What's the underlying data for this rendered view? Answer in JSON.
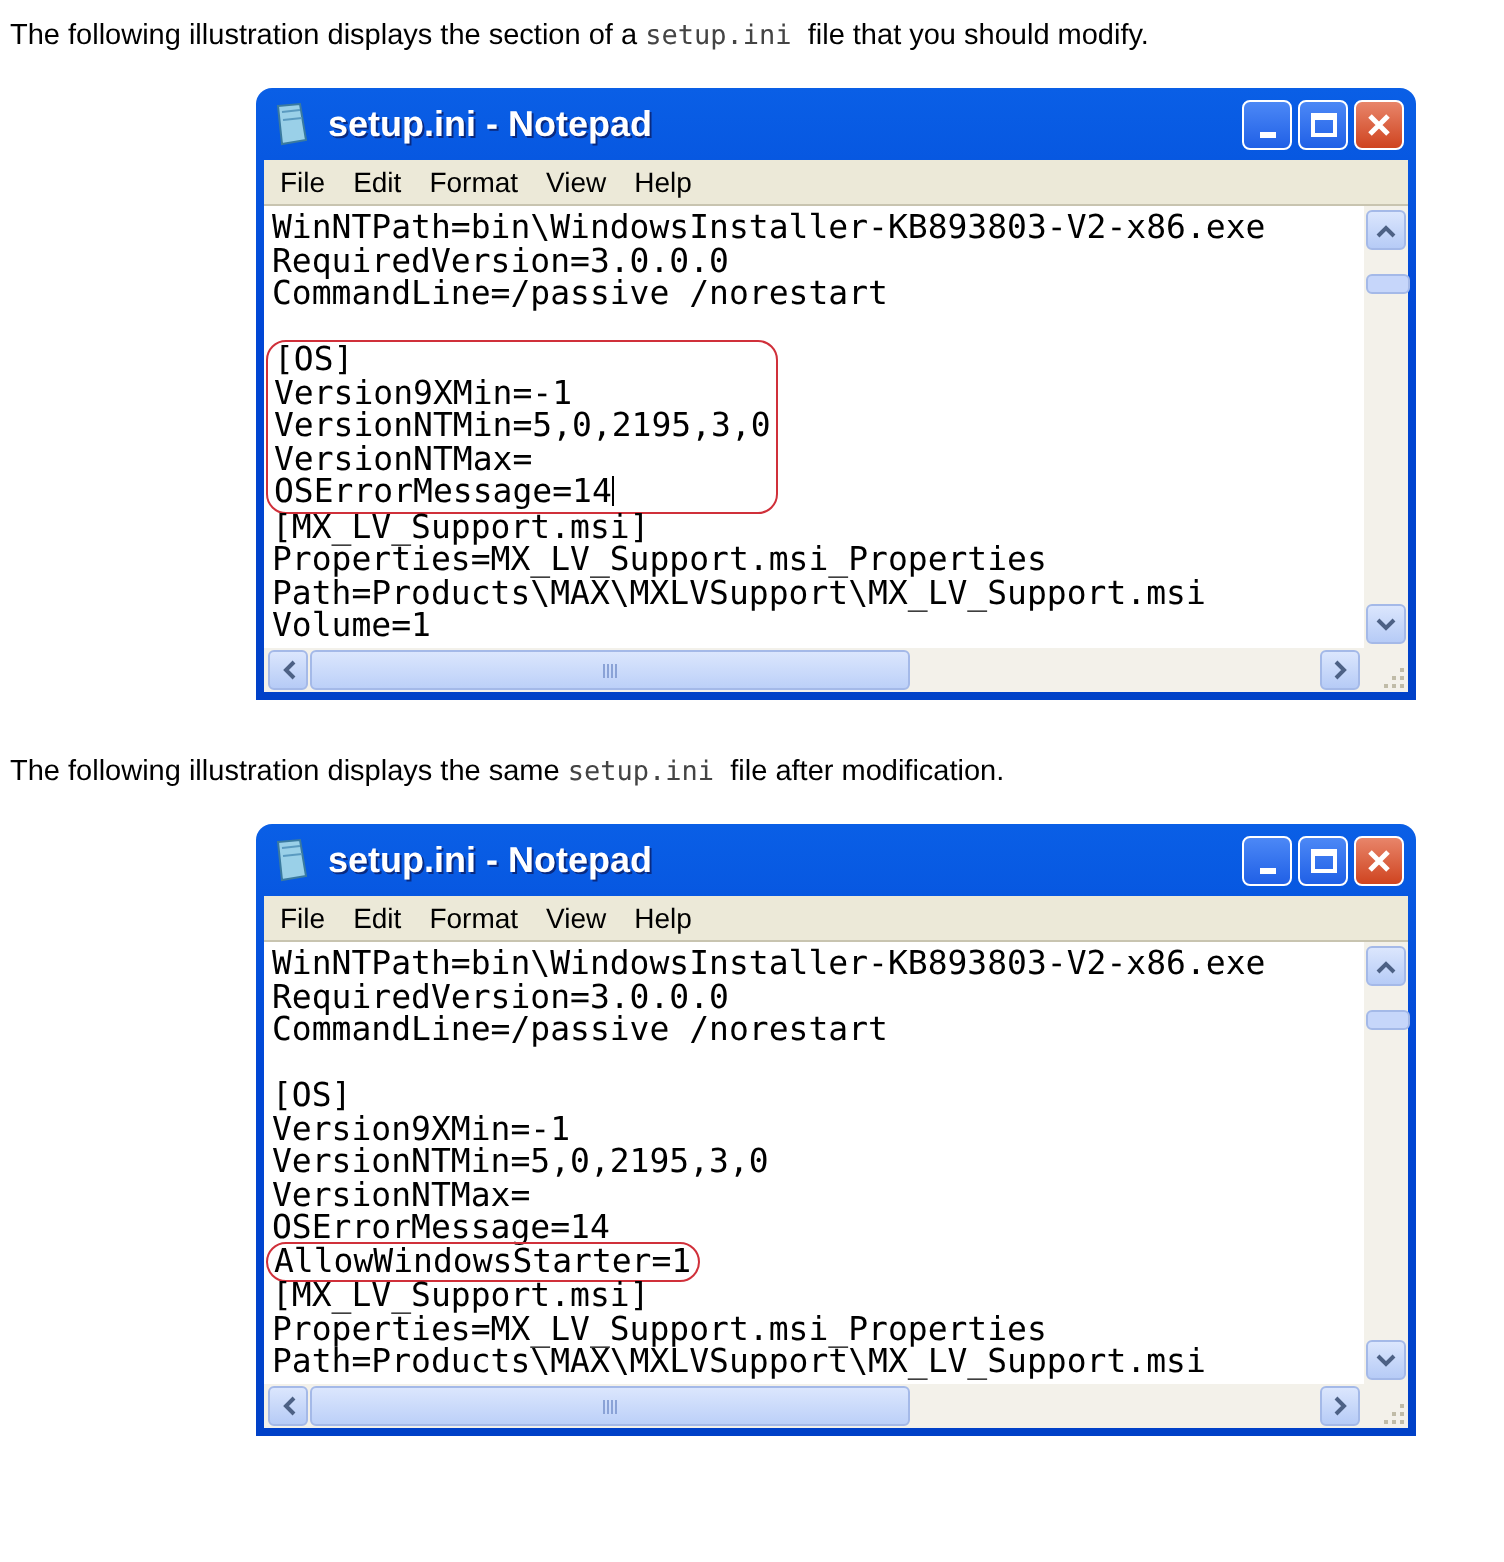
{
  "sections": [
    {
      "caption": [
        {
          "kind": "plain",
          "text": "The following illustration displays the section of a"
        },
        {
          "kind": "code",
          "text": "setup.ini"
        },
        {
          "kind": "plain",
          "text": "file that you should modify."
        }
      ],
      "window": {
        "title": "setup.ini - Notepad",
        "menu": [
          "File",
          "Edit",
          "Format",
          "View",
          "Help"
        ],
        "lines": [
          {
            "kind": "text",
            "text": "WinNTPath=bin\\WindowsInstaller-KB893803-V2-x86.exe",
            "highlighted": false,
            "caret": false
          },
          {
            "kind": "text",
            "text": "RequiredVersion=3.0.0.0",
            "highlighted": false,
            "caret": false
          },
          {
            "kind": "text",
            "text": "CommandLine=/passive /norestart",
            "highlighted": false,
            "caret": false
          },
          {
            "kind": "blank"
          },
          {
            "kind": "text",
            "text": "[OS]",
            "highlighted": true,
            "caret": false
          },
          {
            "kind": "text",
            "text": "Version9XMin=-1",
            "highlighted": true,
            "caret": false
          },
          {
            "kind": "text",
            "text": "VersionNTMin=5,0,2195,3,0",
            "highlighted": true,
            "caret": false
          },
          {
            "kind": "text",
            "text": "VersionNTMax=",
            "highlighted": true,
            "caret": false
          },
          {
            "kind": "text",
            "text": "OSErrorMessage=14",
            "highlighted": true,
            "caret": true
          },
          {
            "kind": "text",
            "text": "[MX_LV_Support.msi]",
            "highlighted": false,
            "caret": false
          },
          {
            "kind": "text",
            "text": "Properties=MX_LV_Support.msi_Properties",
            "highlighted": false,
            "caret": false
          },
          {
            "kind": "text",
            "text": "Path=Products\\MAX\\MXLVSupport\\MX_LV_Support.msi",
            "highlighted": false,
            "caret": false
          },
          {
            "kind": "text",
            "text": "Volume=1",
            "highlighted": false,
            "caret": false
          }
        ]
      }
    },
    {
      "caption": [
        {
          "kind": "plain",
          "text": "The following illustration displays the same"
        },
        {
          "kind": "code",
          "text": "setup.ini"
        },
        {
          "kind": "plain",
          "text": "file after modification."
        }
      ],
      "window": {
        "title": "setup.ini - Notepad",
        "menu": [
          "File",
          "Edit",
          "Format",
          "View",
          "Help"
        ],
        "lines": [
          {
            "kind": "text",
            "text": "WinNTPath=bin\\WindowsInstaller-KB893803-V2-x86.exe",
            "highlighted": false,
            "caret": false
          },
          {
            "kind": "text",
            "text": "RequiredVersion=3.0.0.0",
            "highlighted": false,
            "caret": false
          },
          {
            "kind": "text",
            "text": "CommandLine=/passive /norestart",
            "highlighted": false,
            "caret": false
          },
          {
            "kind": "blank"
          },
          {
            "kind": "text",
            "text": "[OS]",
            "highlighted": false,
            "caret": false
          },
          {
            "kind": "text",
            "text": "Version9XMin=-1",
            "highlighted": false,
            "caret": false
          },
          {
            "kind": "text",
            "text": "VersionNTMin=5,0,2195,3,0",
            "highlighted": false,
            "caret": false
          },
          {
            "kind": "text",
            "text": "VersionNTMax=",
            "highlighted": false,
            "caret": false
          },
          {
            "kind": "text",
            "text": "OSErrorMessage=14",
            "highlighted": false,
            "caret": false
          },
          {
            "kind": "text",
            "text": "AllowWindowsStarter=1",
            "highlighted": true,
            "caret": false
          },
          {
            "kind": "text",
            "text": "[MX_LV_Support.msi]",
            "highlighted": false,
            "caret": false
          },
          {
            "kind": "text",
            "text": "Properties=MX_LV_Support.msi_Properties",
            "highlighted": false,
            "caret": false
          },
          {
            "kind": "text",
            "text": "Path=Products\\MAX\\MXLVSupport\\MX_LV_Support.msi",
            "highlighted": false,
            "caret": false
          }
        ]
      }
    }
  ]
}
